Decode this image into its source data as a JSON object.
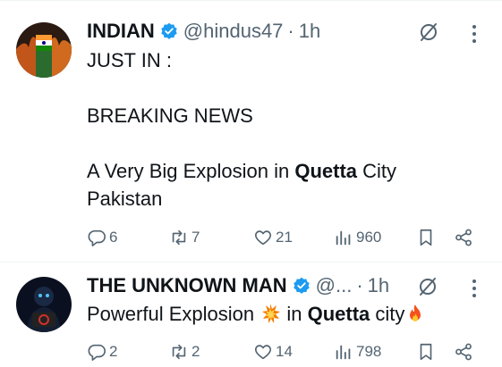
{
  "tweets": [
    {
      "name": "INDIAN",
      "handle": "@hindus47",
      "time": "1h",
      "text": {
        "l1": "JUST IN :",
        "l2": "BREAKING NEWS",
        "l3_pre": "A Very Big Explosion in ",
        "l3_bold": "Quetta",
        "l3_post": " City",
        "l4": "Pakistan"
      },
      "stats": {
        "replies": "6",
        "reposts": "7",
        "likes": "21",
        "views": "960"
      }
    },
    {
      "name": "THE UNKNOWN MAN",
      "handle": "@...",
      "time": "1h",
      "text": {
        "pre": "Powerful Explosion ",
        "mid": " in ",
        "bold": "Quetta",
        "post": " city"
      },
      "stats": {
        "replies": "2",
        "reposts": "2",
        "likes": "14",
        "views": "798"
      }
    }
  ],
  "icons": {
    "verified": "verified-badge-icon",
    "grok": "grok-icon",
    "more": "more-icon",
    "reply": "reply-icon",
    "repost": "repost-icon",
    "like": "like-icon",
    "views": "views-icon",
    "bookmark": "bookmark-icon",
    "share": "share-icon",
    "collision": "collision-emoji",
    "fire": "fire-emoji"
  },
  "colors": {
    "accent": "#1d9bf0",
    "muted": "#536471",
    "text": "#0f1419"
  }
}
